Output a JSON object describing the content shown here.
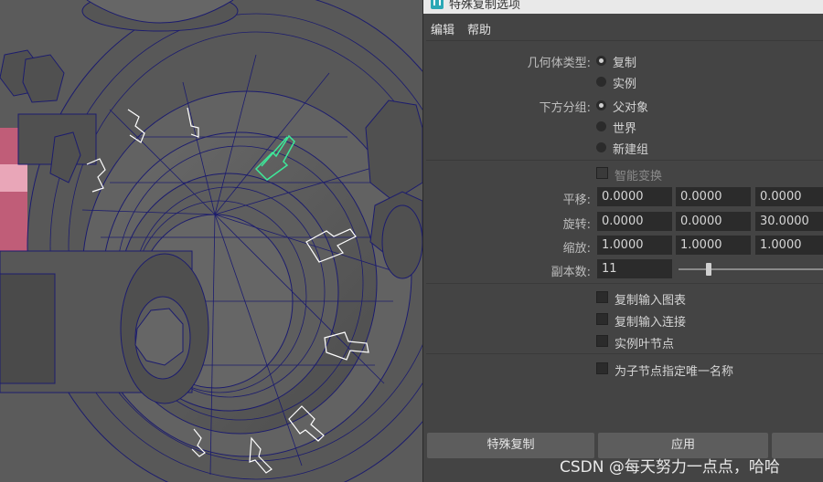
{
  "dialog": {
    "title": "特殊复制选项",
    "menu": [
      "编辑",
      "帮助"
    ],
    "geometry_type": {
      "label": "几何体类型:",
      "options": [
        {
          "label": "复制",
          "selected": true
        },
        {
          "label": "实例",
          "selected": false
        }
      ]
    },
    "group_under": {
      "label": "下方分组:",
      "options": [
        {
          "label": "父对象",
          "selected": true
        },
        {
          "label": "世界",
          "selected": false
        },
        {
          "label": "新建组",
          "selected": false
        }
      ]
    },
    "smart_transform": {
      "label": "智能变换",
      "checked": false,
      "enabled": false
    },
    "translate": {
      "label": "平移:",
      "values": [
        "0.0000",
        "0.0000",
        "0.0000"
      ]
    },
    "rotate": {
      "label": "旋转:",
      "values": [
        "0.0000",
        "0.0000",
        "30.0000"
      ]
    },
    "scale": {
      "label": "缩放:",
      "values": [
        "1.0000",
        "1.0000",
        "1.0000"
      ]
    },
    "copies": {
      "label": "副本数:",
      "value": "11"
    },
    "checkboxes": [
      {
        "label": "复制输入图表",
        "checked": false
      },
      {
        "label": "复制输入连接",
        "checked": false
      },
      {
        "label": "实例叶节点",
        "checked": false
      },
      {
        "label": "为子节点指定唯一名称",
        "checked": false
      }
    ],
    "buttons": [
      "特殊复制",
      "应用"
    ]
  },
  "watermark": "CSDN @每天努力一点点，哈哈",
  "colors": {
    "wireframe": "#1c1c6e",
    "selected": "#3ee89a",
    "dialog_bg": "#444444"
  }
}
